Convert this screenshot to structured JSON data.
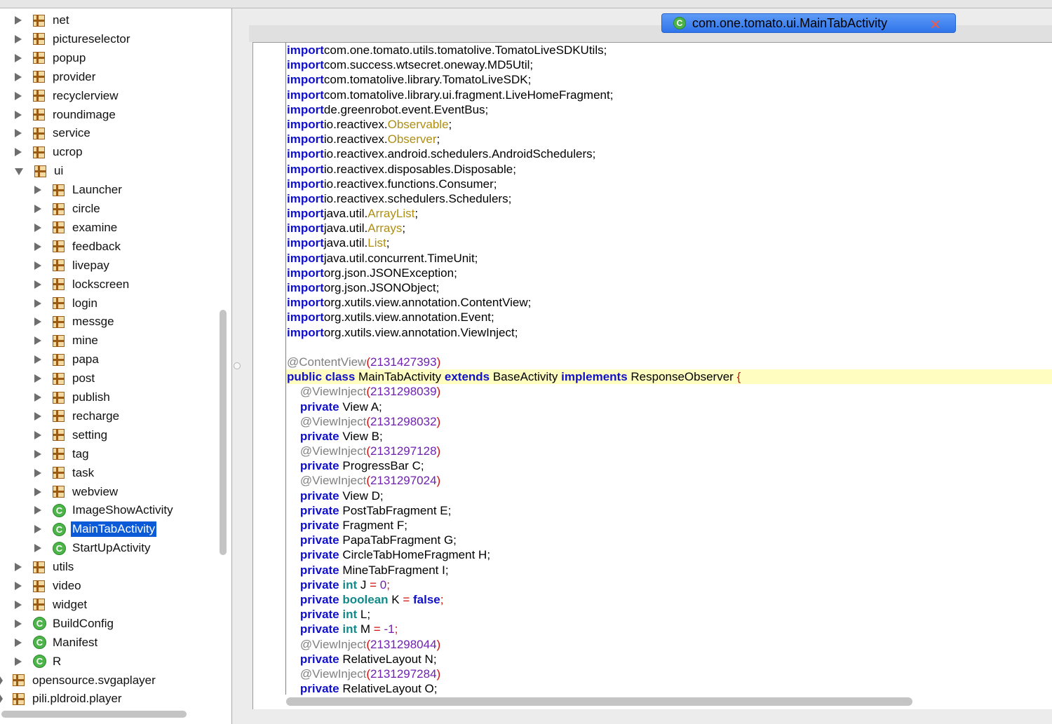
{
  "tree": {
    "items": [
      {
        "label": "net",
        "icon": "package-icon",
        "expanded": false
      },
      {
        "label": "pictureselector",
        "icon": "package-icon",
        "expanded": false
      },
      {
        "label": "popup",
        "icon": "package-icon",
        "expanded": false
      },
      {
        "label": "provider",
        "icon": "package-icon",
        "expanded": false
      },
      {
        "label": "recyclerview",
        "icon": "package-icon",
        "expanded": false
      },
      {
        "label": "roundimage",
        "icon": "package-icon",
        "expanded": false
      },
      {
        "label": "service",
        "icon": "package-icon",
        "expanded": false
      },
      {
        "label": "ucrop",
        "icon": "package-icon",
        "expanded": false
      },
      {
        "label": "ui",
        "icon": "package-icon",
        "expanded": true
      },
      {
        "label": "Launcher",
        "icon": "package-icon",
        "expanded": false
      },
      {
        "label": "circle",
        "icon": "package-icon",
        "expanded": false
      },
      {
        "label": "examine",
        "icon": "package-icon",
        "expanded": false
      },
      {
        "label": "feedback",
        "icon": "package-icon",
        "expanded": false
      },
      {
        "label": "livepay",
        "icon": "package-icon",
        "expanded": false
      },
      {
        "label": "lockscreen",
        "icon": "package-icon",
        "expanded": false
      },
      {
        "label": "login",
        "icon": "package-icon",
        "expanded": false
      },
      {
        "label": "messge",
        "icon": "package-icon",
        "expanded": false
      },
      {
        "label": "mine",
        "icon": "package-icon",
        "expanded": false
      },
      {
        "label": "papa",
        "icon": "package-icon",
        "expanded": false
      },
      {
        "label": "post",
        "icon": "package-icon",
        "expanded": false
      },
      {
        "label": "publish",
        "icon": "package-icon",
        "expanded": false
      },
      {
        "label": "recharge",
        "icon": "package-icon",
        "expanded": false
      },
      {
        "label": "setting",
        "icon": "package-icon",
        "expanded": false
      },
      {
        "label": "tag",
        "icon": "package-icon",
        "expanded": false
      },
      {
        "label": "task",
        "icon": "package-icon",
        "expanded": false
      },
      {
        "label": "webview",
        "icon": "package-icon",
        "expanded": false
      },
      {
        "label": "ImageShowActivity",
        "icon": "class-icon",
        "expanded": false
      },
      {
        "label": "MainTabActivity",
        "icon": "class-icon",
        "expanded": false,
        "selected": true
      },
      {
        "label": "StartUpActivity",
        "icon": "class-icon",
        "expanded": false
      },
      {
        "label": "utils",
        "icon": "package-icon",
        "expanded": false
      },
      {
        "label": "video",
        "icon": "package-icon",
        "expanded": false
      },
      {
        "label": "widget",
        "icon": "package-icon",
        "expanded": false
      },
      {
        "label": "BuildConfig",
        "icon": "class-icon",
        "expanded": false
      },
      {
        "label": "Manifest",
        "icon": "class-icon",
        "expanded": false
      },
      {
        "label": "R",
        "icon": "class-icon",
        "expanded": false
      },
      {
        "label": "opensource.svgaplayer",
        "icon": "package-icon",
        "expanded": false
      },
      {
        "label": "pili.pldroid.player",
        "icon": "package-icon",
        "expanded": false
      }
    ]
  },
  "editor": {
    "tab_title": "com.one.tomato.ui.MainTabActivity",
    "tab_icon": "class-icon",
    "tab_close_glyph": "✕",
    "class_icon_glyph": "C",
    "code_lines": [
      [
        [
          "kw",
          "import"
        ],
        [
          "",
          "com.one.tomato.utils.tomatolive.TomatoLiveSDKUtils;"
        ]
      ],
      [
        [
          "kw",
          "import"
        ],
        [
          "",
          "com.success.wtsecret.oneway.MD5Util;"
        ]
      ],
      [
        [
          "kw",
          "import"
        ],
        [
          "",
          "com.tomatolive.library.TomatoLiveSDK;"
        ]
      ],
      [
        [
          "kw",
          "import"
        ],
        [
          "",
          "com.tomatolive.library.ui.fragment.LiveHomeFragment;"
        ]
      ],
      [
        [
          "kw",
          "import"
        ],
        [
          "",
          "de.greenrobot.event.EventBus;"
        ]
      ],
      [
        [
          "kw",
          "import"
        ],
        [
          "",
          "io.reactivex."
        ],
        [
          "cls",
          "Observable"
        ],
        [
          "",
          ";"
        ]
      ],
      [
        [
          "kw",
          "import"
        ],
        [
          "",
          "io.reactivex."
        ],
        [
          "cls",
          "Observer"
        ],
        [
          "",
          ";"
        ]
      ],
      [
        [
          "kw",
          "import"
        ],
        [
          "",
          "io.reactivex.android.schedulers.AndroidSchedulers;"
        ]
      ],
      [
        [
          "kw",
          "import"
        ],
        [
          "",
          "io.reactivex.disposables.Disposable;"
        ]
      ],
      [
        [
          "kw",
          "import"
        ],
        [
          "",
          "io.reactivex.functions.Consumer;"
        ]
      ],
      [
        [
          "kw",
          "import"
        ],
        [
          "",
          "io.reactivex.schedulers.Schedulers;"
        ]
      ],
      [
        [
          "kw",
          "import"
        ],
        [
          "",
          "java.util."
        ],
        [
          "cls",
          "ArrayList"
        ],
        [
          "",
          ";"
        ]
      ],
      [
        [
          "kw",
          "import"
        ],
        [
          "",
          "java.util."
        ],
        [
          "cls",
          "Arrays"
        ],
        [
          "",
          ";"
        ]
      ],
      [
        [
          "kw",
          "import"
        ],
        [
          "",
          "java.util."
        ],
        [
          "cls",
          "List"
        ],
        [
          "",
          ";"
        ]
      ],
      [
        [
          "kw",
          "import"
        ],
        [
          "",
          "java.util.concurrent.TimeUnit;"
        ]
      ],
      [
        [
          "kw",
          "import"
        ],
        [
          "",
          "org.json.JSONException;"
        ]
      ],
      [
        [
          "kw",
          "import"
        ],
        [
          "",
          "org.json.JSONObject;"
        ]
      ],
      [
        [
          "kw",
          "import"
        ],
        [
          "",
          "org.xutils.view.annotation.ContentView;"
        ]
      ],
      [
        [
          "kw",
          "import"
        ],
        [
          "",
          "org.xutils.view.annotation.Event;"
        ]
      ],
      [
        [
          "kw",
          "import"
        ],
        [
          "",
          "org.xutils.view.annotation.ViewInject;"
        ]
      ],
      [],
      [
        [
          "ann",
          "@ContentView"
        ],
        [
          "rd",
          "("
        ],
        [
          "num",
          "2131427393"
        ],
        [
          "rd",
          ")"
        ]
      ],
      [
        [
          "kw",
          "public class"
        ],
        [
          "",
          " MainTabActivity "
        ],
        [
          "kw",
          "extends"
        ],
        [
          "",
          " BaseActivity "
        ],
        [
          "kw",
          "implements"
        ],
        [
          "",
          " ResponseObserver "
        ],
        [
          "rd",
          "{"
        ]
      ],
      [
        [
          "ann",
          "    @ViewInject"
        ],
        [
          "rd",
          "("
        ],
        [
          "num",
          "2131298039"
        ],
        [
          "rd",
          ")"
        ]
      ],
      [
        [
          "kw",
          "    private"
        ],
        [
          "",
          " View A;"
        ]
      ],
      [
        [
          "ann",
          "    @ViewInject"
        ],
        [
          "rd",
          "("
        ],
        [
          "num",
          "2131298032"
        ],
        [
          "rd",
          ")"
        ]
      ],
      [
        [
          "kw",
          "    private"
        ],
        [
          "",
          " View B;"
        ]
      ],
      [
        [
          "ann",
          "    @ViewInject"
        ],
        [
          "rd",
          "("
        ],
        [
          "num",
          "2131297128"
        ],
        [
          "rd",
          ")"
        ]
      ],
      [
        [
          "kw",
          "    private"
        ],
        [
          "",
          " ProgressBar C;"
        ]
      ],
      [
        [
          "ann",
          "    @ViewInject"
        ],
        [
          "rd",
          "("
        ],
        [
          "num",
          "2131297024"
        ],
        [
          "rd",
          ")"
        ]
      ],
      [
        [
          "kw",
          "    private"
        ],
        [
          "",
          " View D;"
        ]
      ],
      [
        [
          "kw",
          "    private"
        ],
        [
          "",
          " PostTabFragment E;"
        ]
      ],
      [
        [
          "kw",
          "    private"
        ],
        [
          "",
          " Fragment F;"
        ]
      ],
      [
        [
          "kw",
          "    private"
        ],
        [
          "",
          " PapaTabFragment G;"
        ]
      ],
      [
        [
          "kw",
          "    private"
        ],
        [
          "",
          " CircleTabHomeFragment H;"
        ]
      ],
      [
        [
          "kw",
          "    private"
        ],
        [
          "",
          " MineTabFragment I;"
        ]
      ],
      [
        [
          "kw",
          "    private"
        ],
        [
          " ",
          ""
        ],
        [
          "tp",
          "int"
        ],
        [
          "",
          " J "
        ],
        [
          "rd",
          "="
        ],
        [
          " ",
          ""
        ],
        [
          "num",
          "0"
        ],
        [
          "rd",
          ";"
        ]
      ],
      [
        [
          "kw",
          "    private"
        ],
        [
          " ",
          ""
        ],
        [
          "tp",
          "boolean"
        ],
        [
          "",
          " K "
        ],
        [
          "rd",
          "="
        ],
        [
          " ",
          ""
        ],
        [
          "kw",
          "false"
        ],
        [
          "rd",
          ";"
        ]
      ],
      [
        [
          "kw",
          "    private"
        ],
        [
          " ",
          ""
        ],
        [
          "tp",
          "int"
        ],
        [
          "",
          " L;"
        ]
      ],
      [
        [
          "kw",
          "    private"
        ],
        [
          " ",
          ""
        ],
        [
          "tp",
          "int"
        ],
        [
          "",
          " M "
        ],
        [
          "rd",
          "="
        ],
        [
          " ",
          ""
        ],
        [
          "num",
          "-1"
        ],
        [
          "rd",
          ";"
        ]
      ],
      [
        [
          "ann",
          "    @ViewInject"
        ],
        [
          "rd",
          "("
        ],
        [
          "num",
          "2131298044"
        ],
        [
          "rd",
          ")"
        ]
      ],
      [
        [
          "kw",
          "    private"
        ],
        [
          "",
          " RelativeLayout N;"
        ]
      ],
      [
        [
          "ann",
          "    @ViewInject"
        ],
        [
          "rd",
          "("
        ],
        [
          "num",
          "2131297284"
        ],
        [
          "rd",
          ")"
        ]
      ],
      [
        [
          "kw",
          "    private"
        ],
        [
          "",
          " RelativeLayout O;"
        ]
      ]
    ],
    "highlight_line": 22
  },
  "colors": {
    "keyword": "#1010cc",
    "class_ref": "#b08e12",
    "annotation": "#808080",
    "number": "#6f20b0",
    "selection": "#0b5ad8",
    "line_highlight": "#fffec0"
  }
}
